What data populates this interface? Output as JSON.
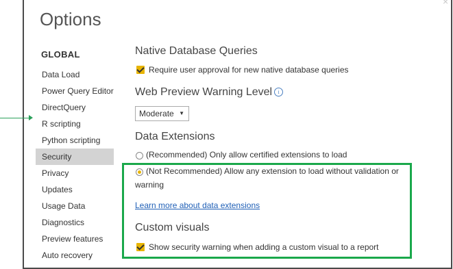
{
  "dialog": {
    "title": "Options",
    "close_glyph": "×"
  },
  "sidebar": {
    "heading": "GLOBAL",
    "items": [
      {
        "label": "Data Load"
      },
      {
        "label": "Power Query Editor"
      },
      {
        "label": "DirectQuery"
      },
      {
        "label": "R scripting"
      },
      {
        "label": "Python scripting"
      },
      {
        "label": "Security",
        "selected": true
      },
      {
        "label": "Privacy"
      },
      {
        "label": "Updates"
      },
      {
        "label": "Usage Data"
      },
      {
        "label": "Diagnostics"
      },
      {
        "label": "Preview features"
      },
      {
        "label": "Auto recovery"
      }
    ]
  },
  "main": {
    "native_db": {
      "title": "Native Database Queries",
      "checkbox_label": "Require user approval for new native database queries",
      "checked": true
    },
    "web_preview": {
      "title": "Web Preview Warning Level",
      "info_glyph": "i",
      "dropdown_value": "Moderate",
      "dropdown_chevron": "▼"
    },
    "data_extensions": {
      "title": "Data Extensions",
      "option_recommended": "(Recommended) Only allow certified extensions to load",
      "option_not_recommended_line1": "(Not Recommended) Allow any extension to load without validation or",
      "option_not_recommended_line2": "warning",
      "selected_option": "not_recommended",
      "learn_more": "Learn more about data extensions"
    },
    "custom_visuals": {
      "title": "Custom visuals",
      "checkbox_label": "Show security warning when adding a custom visual to a report",
      "checked": true
    }
  },
  "colors": {
    "highlight_border": "#1aa84b",
    "checkbox_accent": "#e8b400",
    "link": "#1f5fb6",
    "selected_bg": "#d3d3d3"
  }
}
